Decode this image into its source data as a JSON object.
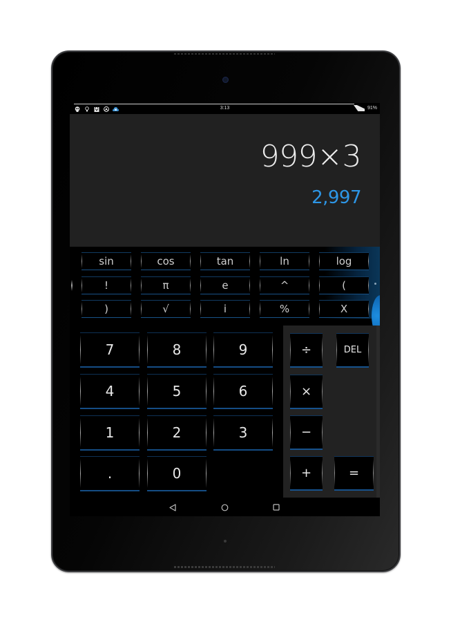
{
  "device": {
    "type": "tablet"
  },
  "status_bar": {
    "notification_icons": [
      "skull-icon",
      "lightbulb-icon",
      "calendar-icon",
      "soccer-ball-icon",
      "cloud-icon"
    ],
    "time": "3:13",
    "battery": "91%"
  },
  "display": {
    "expression": "999×3",
    "result": "2,997",
    "result_color": "#2d96e6"
  },
  "advanced_keys": [
    [
      "sin",
      "cos",
      "tan",
      "ln",
      "log"
    ],
    [
      "!",
      "π",
      "e",
      "^",
      "("
    ],
    [
      ")",
      "√",
      "i",
      "%",
      "X"
    ]
  ],
  "number_keys": [
    [
      "7",
      "8",
      "9"
    ],
    [
      "4",
      "5",
      "6"
    ],
    [
      "1",
      "2",
      "3"
    ],
    [
      ".",
      "0"
    ]
  ],
  "operator_keys": {
    "divide": "÷",
    "delete": "DEL",
    "multiply": "×",
    "subtract": "−",
    "add": "+",
    "equals": "="
  },
  "nav_bar": {
    "back": "back-icon",
    "home": "home-icon",
    "recents": "recents-icon"
  },
  "accent_color": "#1e7fd0"
}
